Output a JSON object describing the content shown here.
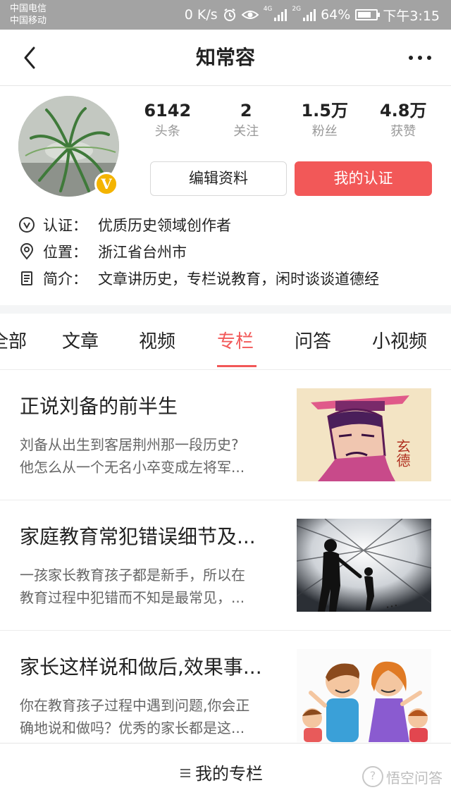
{
  "status_bar": {
    "carrier_1": "中国电信",
    "carrier_2": "中国移动",
    "speed": "0 K/s",
    "net_1": "4G",
    "net_2": "2G",
    "battery": "64%",
    "time": "下午3:15"
  },
  "header": {
    "title": "知常容"
  },
  "profile": {
    "badge": "V",
    "stats": [
      {
        "value": "6142",
        "label": "头条"
      },
      {
        "value": "2",
        "label": "关注"
      },
      {
        "value": "1.5万",
        "label": "粉丝"
      },
      {
        "value": "4.8万",
        "label": "获赞"
      }
    ],
    "edit_button": "编辑资料",
    "verify_button": "我的认证",
    "info": [
      {
        "icon": "verified-icon",
        "label": "认证：",
        "value": "优质历史领域创作者"
      },
      {
        "icon": "location-icon",
        "label": "位置：",
        "value": "浙江省台州市"
      },
      {
        "icon": "document-icon",
        "label": "简介：",
        "value": "文章讲历史，专栏说教育，闲时谈谈道德经"
      }
    ]
  },
  "tabs": [
    "全部",
    "文章",
    "视频",
    "专栏",
    "问答",
    "小视频"
  ],
  "active_tab": "专栏",
  "articles": [
    {
      "title": "正说刘备的前半生",
      "desc_1": "刘备从出生到客居荆州那一段历史?",
      "desc_2": "他怎么从一个无名小卒变成左将军...",
      "thumb_text": "玄德"
    },
    {
      "title": "家庭教育常犯错误细节及...",
      "desc_1": "一孩家长教育孩子都是新手，所以在",
      "desc_2": "教育过程中犯错而不知是最常见，..."
    },
    {
      "title": "家长这样说和做后,效果事...",
      "desc_1": "你在教育孩子过程中遇到问题,你会正",
      "desc_2": "确地说和做吗？优秀的家长都是这..."
    }
  ],
  "bottom_bar": {
    "label": "我的专栏",
    "watermark": "悟空问答"
  },
  "colors": {
    "accent": "#f25858",
    "badge": "#f4b400",
    "status_bar": "#a3a3a3"
  }
}
